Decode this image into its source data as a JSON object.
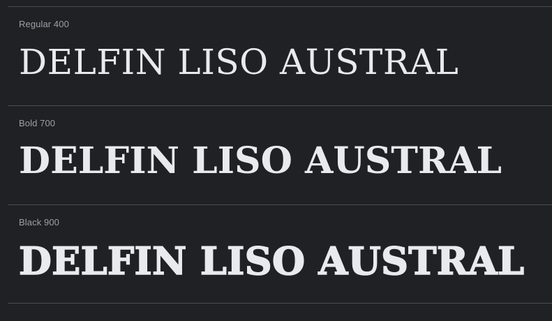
{
  "sample_text": "DELFIN LISO AUSTRAL",
  "styles": [
    {
      "label": "Regular 400"
    },
    {
      "label": "Bold 700"
    },
    {
      "label": "Black 900"
    }
  ],
  "colors": {
    "background": "#202124",
    "divider": "#4a4c50",
    "label": "#9aa0a6",
    "sample": "#e8eaed"
  }
}
